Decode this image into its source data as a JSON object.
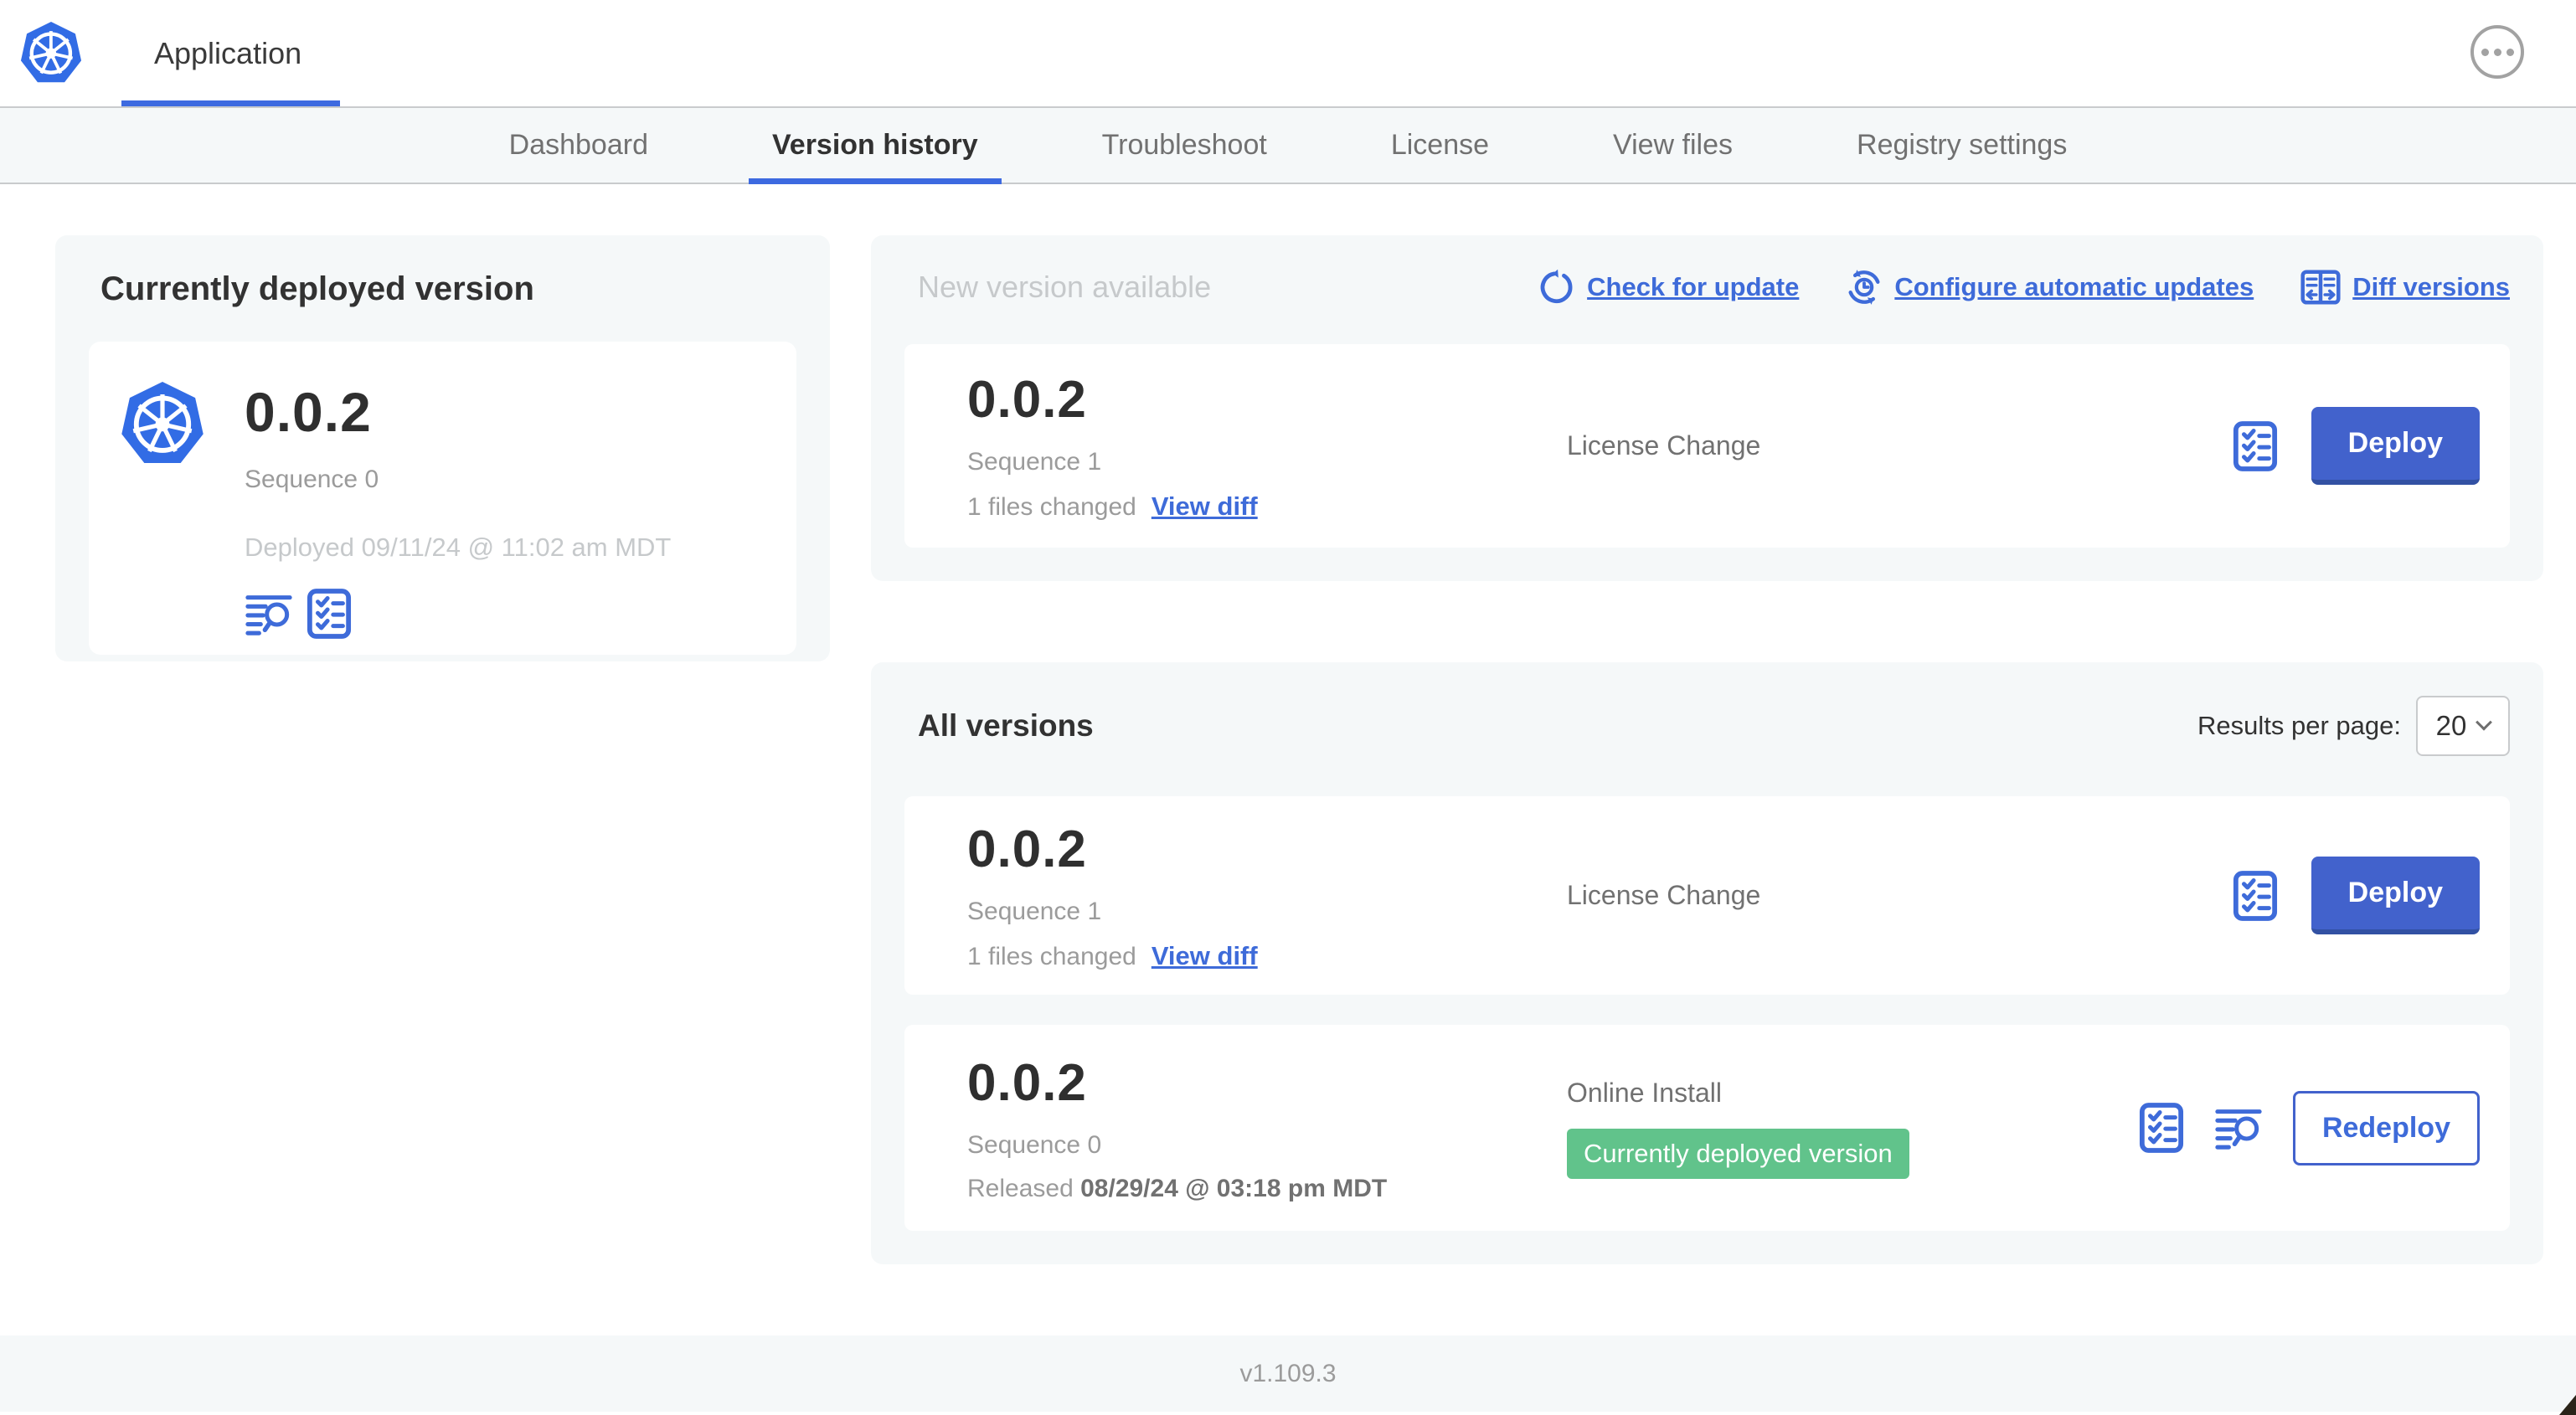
{
  "app": {
    "title": "Application"
  },
  "nav": {
    "tabs": [
      {
        "label": "Dashboard",
        "active": false
      },
      {
        "label": "Version history",
        "active": true
      },
      {
        "label": "Troubleshoot",
        "active": false
      },
      {
        "label": "License",
        "active": false
      },
      {
        "label": "View files",
        "active": false
      },
      {
        "label": "Registry settings",
        "active": false
      }
    ]
  },
  "current": {
    "title": "Currently deployed version",
    "version": "0.0.2",
    "sequence": "Sequence 0",
    "deployed": "Deployed 09/11/24 @ 11:02 am MDT"
  },
  "new_version": {
    "title": "New version available",
    "links": [
      {
        "label": "Check for update",
        "icon": "refresh-icon"
      },
      {
        "label": "Configure automatic updates",
        "icon": "clock-refresh-icon"
      },
      {
        "label": "Diff versions",
        "icon": "diff-columns-icon"
      }
    ],
    "card": {
      "version": "0.0.2",
      "sequence": "Sequence 1",
      "files_changed": "1 files changed",
      "view_diff": "View diff",
      "source": "License Change",
      "action": "Deploy"
    }
  },
  "all_versions": {
    "title": "All versions",
    "results_label": "Results per page:",
    "results_value": "20",
    "rows": [
      {
        "version": "0.0.2",
        "sequence": "Sequence 1",
        "files_changed": "1 files changed",
        "view_diff": "View diff",
        "source": "License Change",
        "action": "Deploy"
      },
      {
        "version": "0.0.2",
        "sequence": "Sequence 0",
        "released_prefix": "Released",
        "released_date": "08/29/24 @ 03:18 pm MDT",
        "source": "Online Install",
        "badge": "Currently deployed version",
        "action": "Redeploy"
      }
    ]
  },
  "footer": {
    "version": "v1.109.3"
  },
  "colors": {
    "accent_blue": "#4262cc",
    "link_blue": "#3e6bd9",
    "k8s_blue": "#326ce5",
    "badge_green": "#61c38b",
    "panel_bg": "#f5f8f9",
    "text_dark": "#323232",
    "text_gray": "#717171",
    "text_light": "#9b9b9b",
    "text_lighter": "#c6c9cb"
  }
}
